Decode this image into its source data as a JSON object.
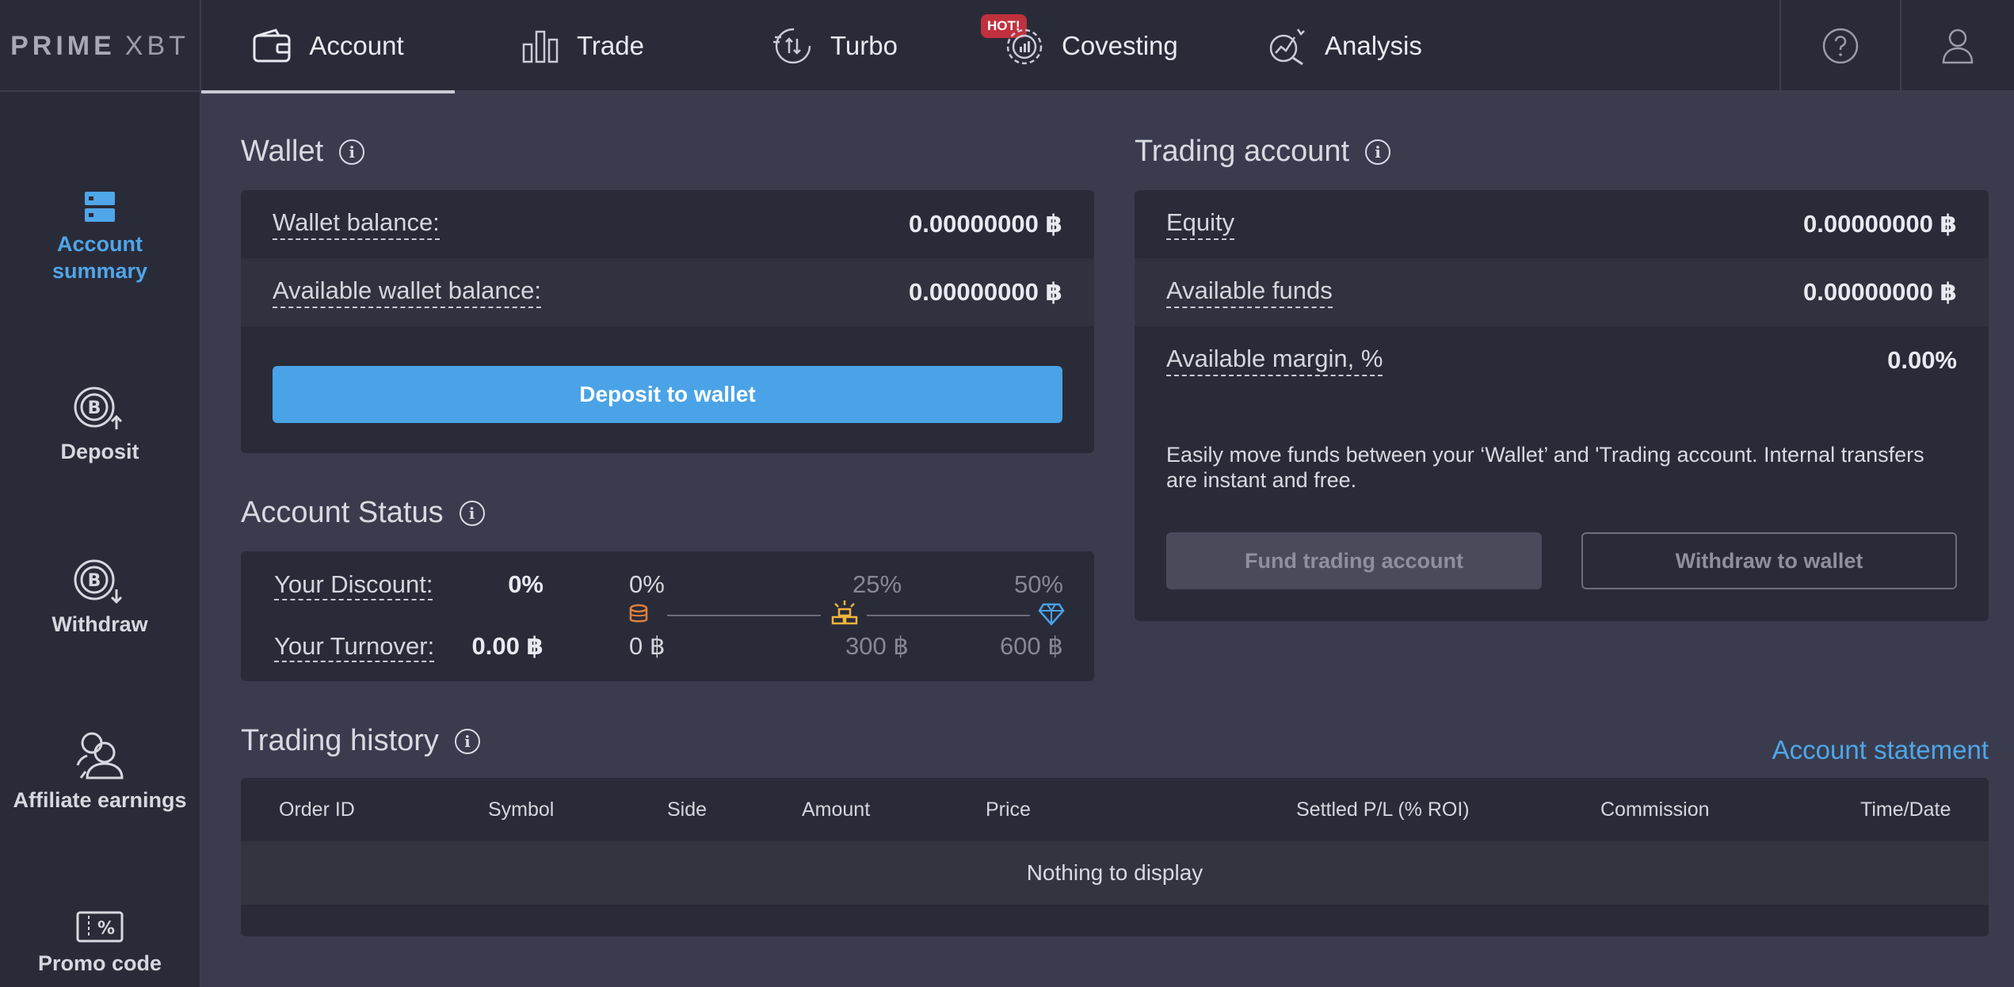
{
  "logo": {
    "bold": "PRIME",
    "light": "XBT"
  },
  "nav": {
    "account": "Account",
    "trade": "Trade",
    "turbo": "Turbo",
    "covesting": "Covesting",
    "covesting_badge": "HOT!",
    "analysis": "Analysis"
  },
  "sidebar": {
    "account_summary": "Account summary",
    "deposit": "Deposit",
    "withdraw": "Withdraw",
    "affiliate": "Affiliate earnings",
    "promo": "Promo code"
  },
  "wallet": {
    "title": "Wallet",
    "balance_label": "Wallet balance:",
    "balance_value": "0.00000000 ฿",
    "available_label": "Available wallet balance:",
    "available_value": "0.00000000 ฿",
    "deposit_button": "Deposit to wallet"
  },
  "trading_account": {
    "title": "Trading account",
    "equity_label": "Equity",
    "equity_value": "0.00000000 ฿",
    "funds_label": "Available funds",
    "funds_value": "0.00000000 ฿",
    "margin_label": "Available margin, %",
    "margin_value": "0.00%",
    "description": "Easily move funds between your ‘Wallet’ and 'Trading account. Internal transfers are instant and free.",
    "fund_button": "Fund trading account",
    "withdraw_button": "Withdraw to wallet"
  },
  "account_status": {
    "title": "Account Status",
    "discount_label": "Your Discount:",
    "discount_value": "0%",
    "turnover_label": "Your Turnover:",
    "turnover_value": "0.00 ฿",
    "tiers": [
      {
        "discount": "0%",
        "turnover": "0 ฿"
      },
      {
        "discount": "25%",
        "turnover": "300 ฿"
      },
      {
        "discount": "50%",
        "turnover": "600 ฿"
      }
    ]
  },
  "trading_history": {
    "title": "Trading history",
    "statement_link": "Account statement",
    "columns": [
      "Order ID",
      "Symbol",
      "Side",
      "Amount",
      "Price",
      "Settled P/L (% ROI)",
      "Commission",
      "Time/Date"
    ],
    "empty": "Nothing to display"
  },
  "colors": {
    "accent": "#4aa3e6",
    "background": "#3a3c4e",
    "panel": "#2a2b39",
    "hot_badge": "#c0303d"
  }
}
